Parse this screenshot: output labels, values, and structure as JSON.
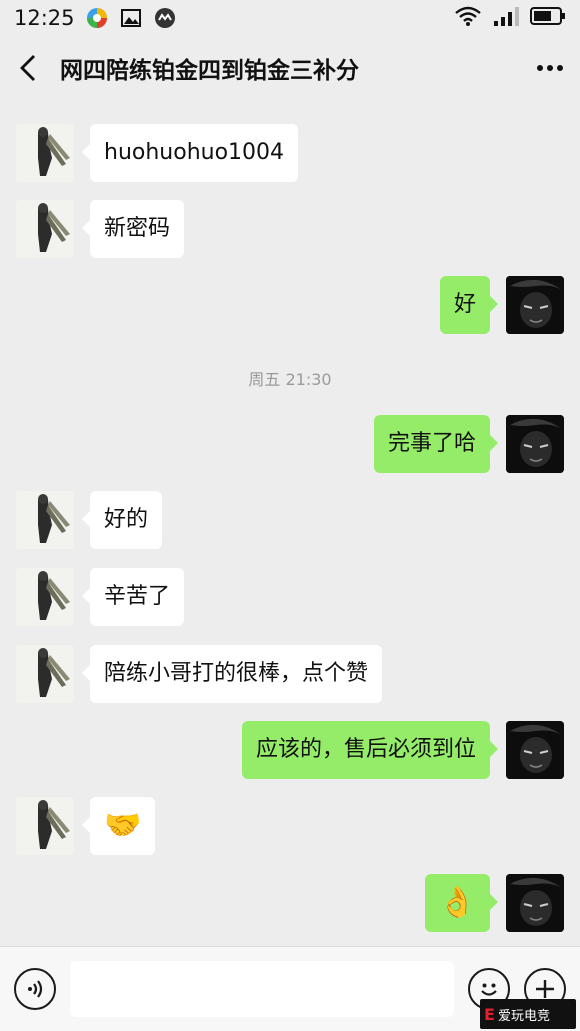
{
  "status_bar": {
    "time": "12:25"
  },
  "header": {
    "title": "网四陪练铂金四到铂金三补分"
  },
  "messages": [
    {
      "side": "left",
      "text": "huohuohuo1004"
    },
    {
      "side": "left",
      "text": "新密码"
    },
    {
      "side": "right",
      "text": "好"
    },
    {
      "side": "right",
      "text": "完事了哈"
    },
    {
      "side": "left",
      "text": "好的"
    },
    {
      "side": "left",
      "text": "辛苦了"
    },
    {
      "side": "left",
      "text": "陪练小哥打的很棒，点个赞"
    },
    {
      "side": "right",
      "text": "应该的，售后必须到位"
    },
    {
      "side": "left",
      "text": "🤝"
    },
    {
      "side": "right",
      "text": "👌"
    }
  ],
  "timestamp": "周五 21:30",
  "watermark": {
    "text": "爱玩电竞"
  },
  "colors": {
    "outgoing_bubble": "#95ec69",
    "incoming_bubble": "#ffffff",
    "background": "#ededed"
  }
}
